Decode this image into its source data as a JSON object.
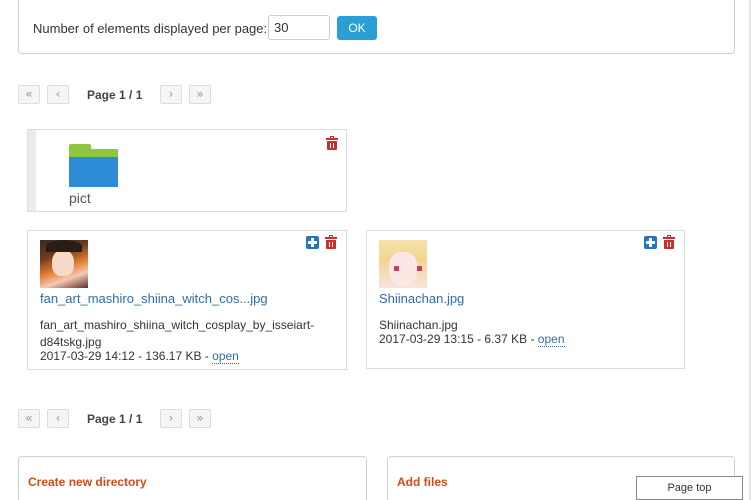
{
  "settings": {
    "per_page_label": "Number of elements displayed per page:",
    "per_page_value": "30",
    "ok_label": "OK"
  },
  "pagination": {
    "first_label": "«",
    "prev_label": "‹",
    "page_label": "Page 1 / 1",
    "next_label": "›",
    "last_label": "»"
  },
  "folder": {
    "name": "pict",
    "icon": "folder-icon",
    "colors": {
      "tab": "#8dc63f",
      "body": "#2e8bd6"
    }
  },
  "files": [
    {
      "link_label": "fan_art_mashiro_shiina_witch_cos...jpg",
      "full_name": "fan_art_mashiro_shiina_witch_cosplay_by_isseiart-d84tskg.jpg",
      "date": "2017-03-29 14:12",
      "size": "136.17 KB",
      "open_label": "open"
    },
    {
      "link_label": "Shiinachan.jpg",
      "full_name": "Shiinachan.jpg",
      "date": "2017-03-29 13:15",
      "size": "6.37 KB",
      "open_label": "open"
    }
  ],
  "panels": {
    "create_directory_title": "Create new directory",
    "add_files_title": "Add files"
  },
  "page_top_label": "Page top",
  "colors": {
    "accent": "#2a9fd6",
    "link": "#2f6ea8",
    "danger": "#c9302c",
    "add": "#2a73b8",
    "panel_title": "#d34b16"
  }
}
